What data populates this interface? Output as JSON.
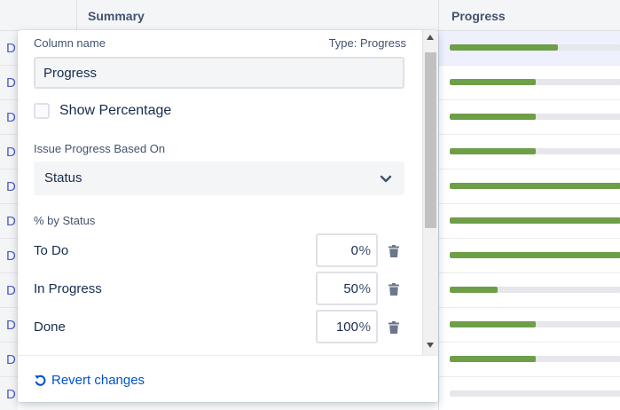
{
  "table": {
    "columns": {
      "summary": "Summary",
      "progress": "Progress"
    },
    "row_key_prefix": "D",
    "progress_values": [
      0.63,
      0.5,
      0.5,
      0.5,
      1.0,
      1.0,
      1.0,
      0.28,
      0.5,
      0.5,
      0.0
    ],
    "highlighted_row": 0
  },
  "panel": {
    "column_name_label": "Column name",
    "type_label": "Type: Progress",
    "column_name_value": "Progress",
    "show_percentage_label": "Show Percentage",
    "show_percentage_checked": false,
    "progress_based_on_label": "Issue Progress Based On",
    "progress_based_on_value": "Status",
    "by_status_label": "% by Status",
    "statuses": [
      {
        "name": "To Do",
        "percent": "0"
      },
      {
        "name": "In Progress",
        "percent": "50"
      },
      {
        "name": "Done",
        "percent": "100"
      }
    ],
    "percent_symbol": "%",
    "revert_label": "Revert changes"
  },
  "colors": {
    "progress_fill": "#6e9e48",
    "progress_track": "#e6e7ea",
    "link": "#0052cc",
    "row_highlight": "#eef1fd"
  },
  "icons": {
    "dropdown": "chevron-down-icon",
    "delete": "trash-icon",
    "revert": "undo-icon"
  }
}
